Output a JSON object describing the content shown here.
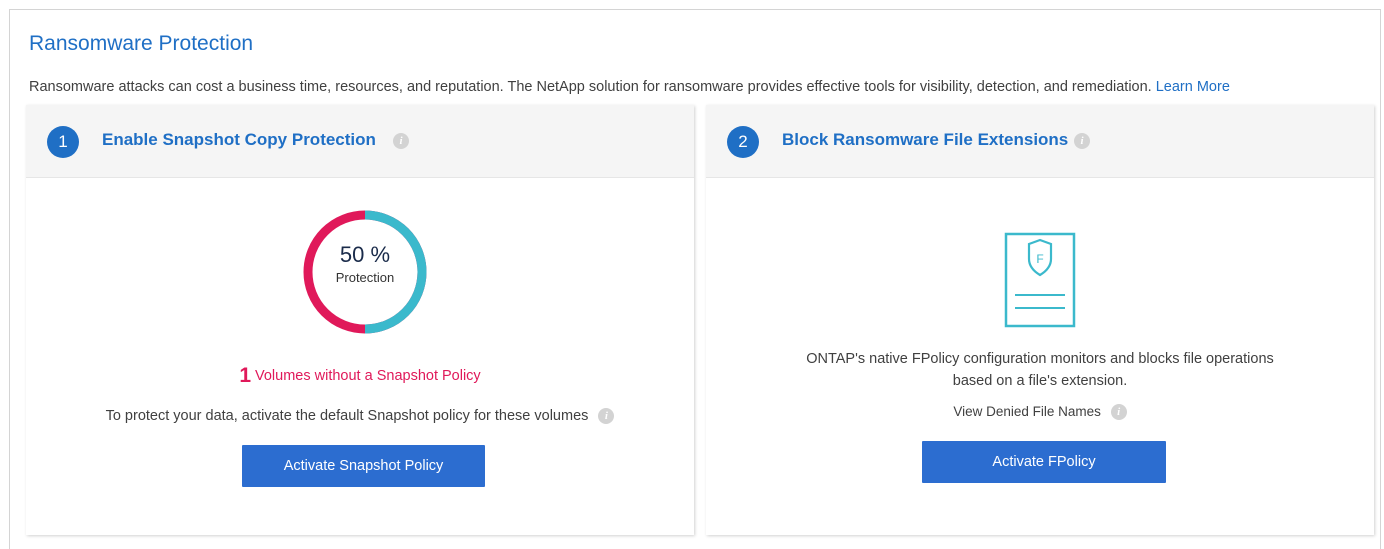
{
  "header": {
    "title": "Ransomware Protection",
    "description": "Ransomware attacks can cost a business time, resources, and reputation. The NetApp solution for ransomware provides effective tools for visibility, detection, and remediation.",
    "learn_more": "Learn More"
  },
  "cards": [
    {
      "step": "1",
      "title": "Enable Snapshot Copy Protection",
      "protection_percent_value": 50,
      "protection_percent": "50 %",
      "protection_label": "Protection",
      "volumes_count": "1",
      "volumes_text": "Volumes without a Snapshot Policy",
      "protect_text": "To protect your data, activate the default Snapshot policy for these volumes",
      "button": "Activate Snapshot Policy"
    },
    {
      "step": "2",
      "title": "Block Ransomware File Extensions",
      "doc_icon_letter": "F",
      "text_line1": "ONTAP's native FPolicy configuration monitors and blocks file operations",
      "text_line2": "based on a file's extension.",
      "view_denied": "View Denied File Names",
      "button": "Activate FPolicy"
    }
  ],
  "colors": {
    "accent": "#1f6fc5",
    "button": "#2c6dd0",
    "alert": "#e0195a",
    "donut_protected": "#3bb9cc",
    "donut_unprotected": "#e0195a",
    "icon_teal": "#3bb9cc"
  },
  "icons": {
    "info": "info-icon",
    "document_shield": "document-shield-icon"
  }
}
